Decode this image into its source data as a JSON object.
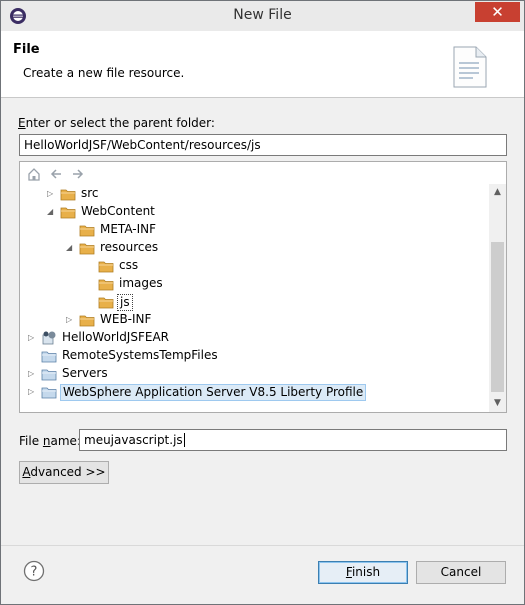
{
  "window": {
    "title": "New File",
    "close_glyph": "✕"
  },
  "header": {
    "title": "File",
    "description": "Create a new file resource."
  },
  "parent_folder": {
    "label_mnemonic": "E",
    "label_rest": "nter or select the parent folder:",
    "value": "HelloWorldJSF/WebContent/resources/js"
  },
  "tree": {
    "toolbar": [
      "home-icon",
      "back-icon",
      "forward-icon"
    ],
    "items": [
      {
        "label": "src",
        "twisty": "collapsed",
        "icon": "folder-icon"
      },
      {
        "label": "WebContent",
        "twisty": "expanded",
        "icon": "folder-icon"
      },
      {
        "label": "META-INF",
        "twisty": "none",
        "icon": "folder-icon"
      },
      {
        "label": "resources",
        "twisty": "expanded",
        "icon": "folder-icon"
      },
      {
        "label": "css",
        "twisty": "none",
        "icon": "folder-icon"
      },
      {
        "label": "images",
        "twisty": "none",
        "icon": "folder-icon"
      },
      {
        "label": "js",
        "twisty": "none",
        "icon": "folder-icon",
        "selected": true
      },
      {
        "label": "WEB-INF",
        "twisty": "collapsed",
        "icon": "folder-icon"
      },
      {
        "label": "HelloWorldJSFEAR",
        "twisty": "collapsed",
        "icon": "ear-project-icon"
      },
      {
        "label": "RemoteSystemsTempFiles",
        "twisty": "none",
        "icon": "project-folder-icon"
      },
      {
        "label": "Servers",
        "twisty": "collapsed",
        "icon": "project-folder-icon"
      },
      {
        "label": "WebSphere Application Server V8.5 Liberty Profile",
        "twisty": "collapsed",
        "icon": "project-folder-icon",
        "highlighted": true
      }
    ]
  },
  "file_name": {
    "label_pre": "File ",
    "label_mnemonic": "n",
    "label_post": "ame:",
    "value": "meujavascript.js"
  },
  "advanced": {
    "mnemonic": "A",
    "rest": "dvanced >>"
  },
  "buttons": {
    "finish_mnemonic": "F",
    "finish_rest": "inish",
    "cancel": "Cancel"
  },
  "colors": {
    "close_button": "#c84031",
    "folder": "#e8b04a",
    "selection_highlight": "#dbeaf7"
  }
}
